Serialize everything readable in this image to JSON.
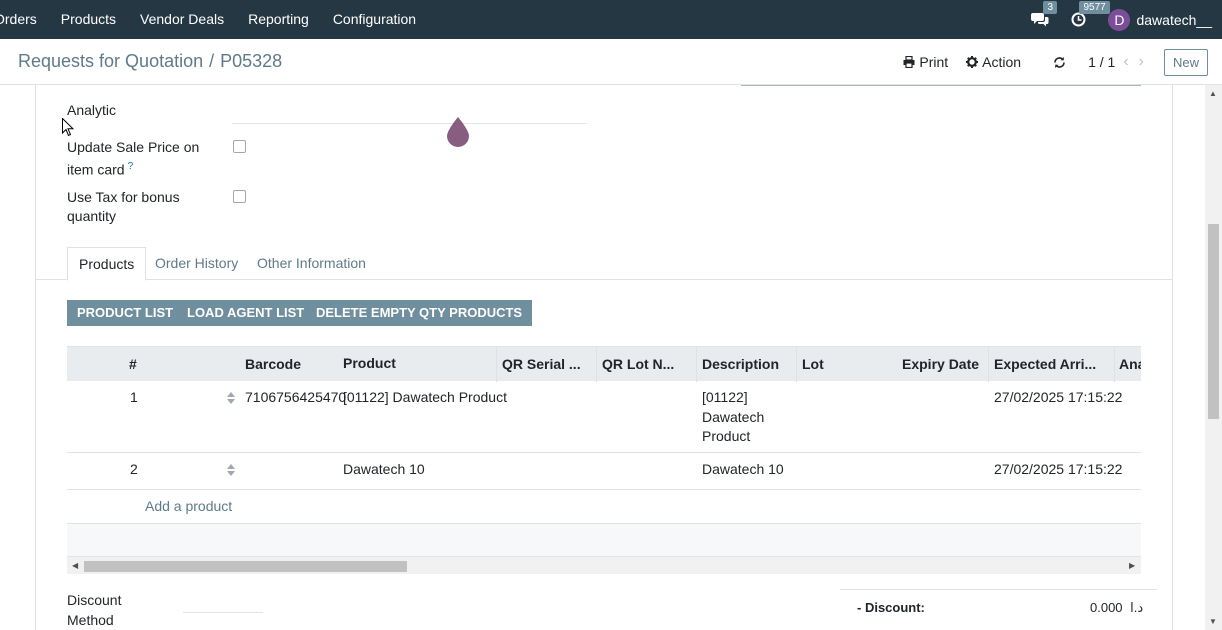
{
  "navbar": {
    "menu": [
      "Orders",
      "Products",
      "Vendor Deals",
      "Reporting",
      "Configuration"
    ],
    "messages_count": "3",
    "activities_count": "9577",
    "user_initial": "D",
    "user_name": "dawatech__",
    "background": "#243742"
  },
  "control_panel": {
    "breadcrumb_parent": "Requests for Quotation",
    "breadcrumb_sep": "/",
    "breadcrumb_current": "P05328",
    "print_label": "Print",
    "action_label": "Action",
    "pager": "1 / 1",
    "new_label": "New"
  },
  "form": {
    "analytic_label": "Analytic",
    "update_price_label": "Update Sale Price on item card",
    "update_price_help": "?",
    "use_tax_label": "Use Tax for bonus quantity",
    "update_price_checked": false,
    "use_tax_checked": false
  },
  "tabs": [
    "Products",
    "Order History",
    "Other Information"
  ],
  "active_tab": "Products",
  "buttons": {
    "product_list": "PRODUCT LIST",
    "load_agent_list": "LOAD AGENT LIST",
    "delete_empty": "DELETE EMPTY QTY PRODUCTS"
  },
  "table": {
    "headers": [
      "#",
      "Barcode",
      "Product",
      "QR Serial ...",
      "QR Lot N...",
      "Description",
      "Lot",
      "Expiry Date",
      "Expected Arri...",
      "Ana"
    ],
    "rows": [
      {
        "seq": "1",
        "barcode": "7106756425470",
        "product": "[01122] Dawatech Product",
        "description": "[01122] Dawatech Product",
        "expected": "27/02/2025 17:15:22"
      },
      {
        "seq": "2",
        "barcode": "",
        "product": "Dawatech 10",
        "description": "Dawatech 10",
        "expected": "27/02/2025 17:15:22"
      }
    ],
    "add_product": "Add a product"
  },
  "footer": {
    "discount_method_label": "Discount Method",
    "discount_label": "- Discount:",
    "discount_value": "0.000",
    "currency": "د.ا"
  },
  "colors": {
    "accent": "#6f8e9e",
    "link": "#5f7a8b",
    "drop": "#7b4d72"
  }
}
